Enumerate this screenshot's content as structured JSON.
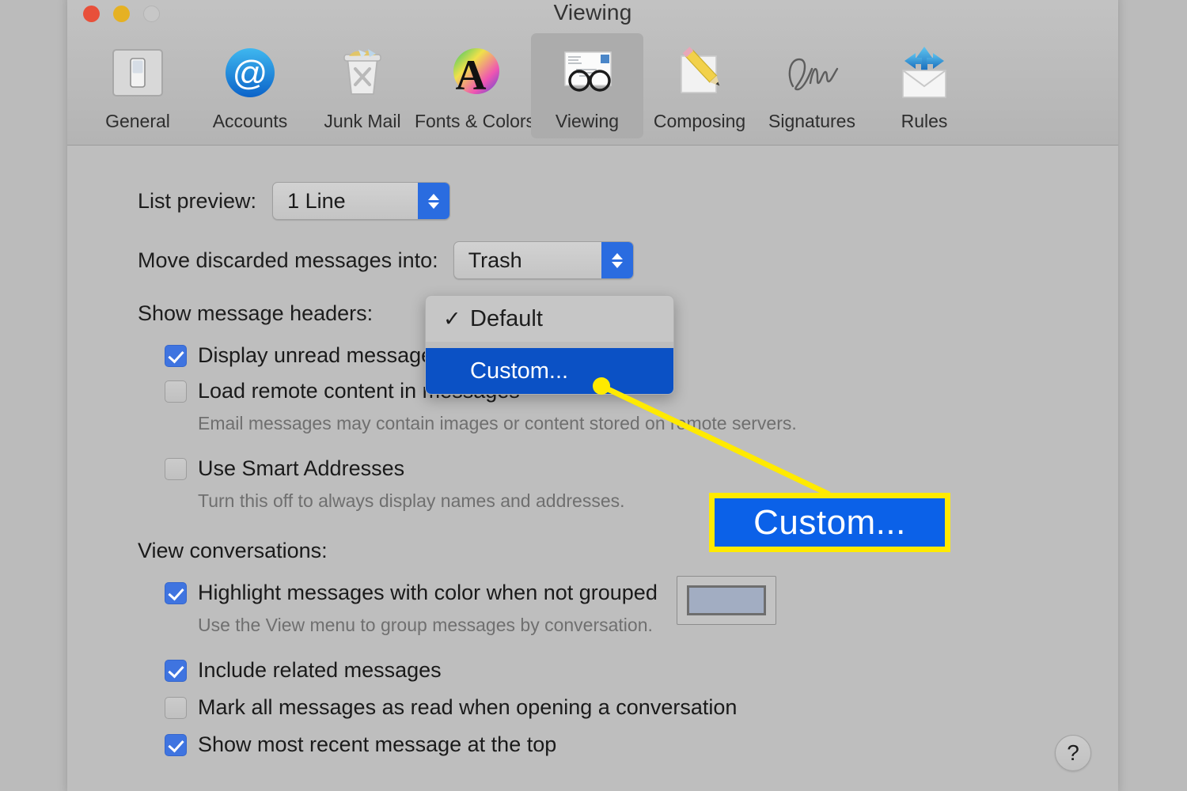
{
  "window": {
    "title": "Viewing",
    "traffic_lights": [
      "close",
      "minimize",
      "zoom"
    ]
  },
  "toolbar": {
    "items": [
      {
        "label": "General",
        "icon": "switch-icon",
        "selected": false
      },
      {
        "label": "Accounts",
        "icon": "at-sign-icon",
        "selected": false
      },
      {
        "label": "Junk Mail",
        "icon": "trash-can-icon",
        "selected": false
      },
      {
        "label": "Fonts & Colors",
        "icon": "font-color-icon",
        "selected": false
      },
      {
        "label": "Viewing",
        "icon": "glasses-mail-icon",
        "selected": true
      },
      {
        "label": "Composing",
        "icon": "pencil-paper-icon",
        "selected": false
      },
      {
        "label": "Signatures",
        "icon": "signature-icon",
        "selected": false
      },
      {
        "label": "Rules",
        "icon": "rules-envelope-icon",
        "selected": false
      }
    ]
  },
  "settings": {
    "list_preview": {
      "label": "List preview:",
      "value": "1 Line"
    },
    "move_discarded": {
      "label": "Move discarded messages into:",
      "value": "Trash"
    },
    "show_message_headers": {
      "label": "Show message headers:"
    },
    "checkboxes": [
      {
        "label": "Display unread messages with bold font",
        "checked": true
      },
      {
        "label": "Load remote content in messages",
        "checked": false
      }
    ],
    "remote_content_hint": "Email messages may contain images or content stored on remote servers.",
    "smart_addresses": {
      "label": "Use Smart Addresses",
      "checked": false,
      "hint": "Turn this off to always display names and addresses."
    },
    "view_conversations": {
      "label": "View conversations:",
      "highlight": {
        "label": "Highlight messages with color when not grouped",
        "checked": true,
        "hint": "Use the View menu to group messages by conversation.",
        "swatch_color": "#a2adc2"
      },
      "options": [
        {
          "label": "Include related messages",
          "checked": true
        },
        {
          "label": "Mark all messages as read when opening a conversation",
          "checked": false
        },
        {
          "label": "Show most recent message at the top",
          "checked": true
        }
      ]
    },
    "help_button": "?"
  },
  "dropdown_menu": {
    "items": [
      {
        "label": "Default",
        "checked": true,
        "highlighted": false
      },
      {
        "label": "Custom...",
        "checked": false,
        "highlighted": true
      }
    ]
  },
  "annotation": {
    "callout_text": "Custom...",
    "border_color": "#ffea00",
    "fill_color": "#0b61e8",
    "line_color": "#ffea00"
  }
}
